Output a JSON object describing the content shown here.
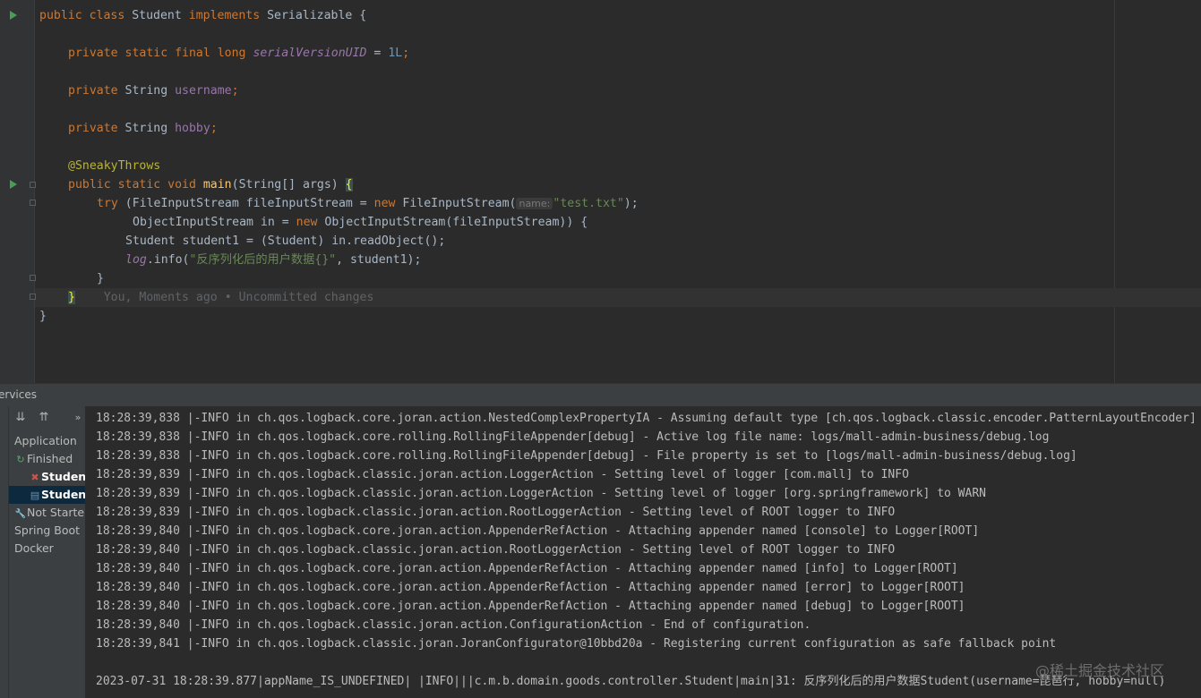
{
  "editor": {
    "lines": {
      "class_decl": {
        "kw1": "public class ",
        "name": "Student ",
        "kw2": "implements ",
        "iface": "Serializable {"
      },
      "serial": {
        "kw": "private static final long ",
        "field": "serialVersionUID",
        "rest": " = ",
        "num": "1L",
        "end": ";"
      },
      "username": {
        "kw": "private ",
        "type": "String ",
        "field": "username",
        "end": ";"
      },
      "hobby": {
        "kw": "private ",
        "type": "String ",
        "field": "hobby",
        "end": ";"
      },
      "annotation": "@SneakyThrows",
      "main": {
        "kw": "public static void ",
        "fn": "main",
        "args": "(String[] args) ",
        "brace": "{"
      },
      "try": {
        "kw": "try ",
        "open": "(FileInputStream fileInputStream = ",
        "kw2": "new ",
        "ctor": "FileInputStream(",
        "hint": "name:",
        "str": "\"test.txt\"",
        "end": ");"
      },
      "ois": {
        "text1": "ObjectInputStream in = ",
        "kw": "new ",
        "text2": "ObjectInputStream(fileInputStream)) {"
      },
      "read": "Student student1 = (Student) in.readObject();",
      "log": {
        "obj": "log",
        "call": ".info(",
        "str": "\"反序列化后的用户数据{}\"",
        "rest": ", student1);"
      },
      "close_try": "}",
      "close_main": "}",
      "blame": "You, Moments ago • Uncommitted changes",
      "close_class": "}"
    }
  },
  "services": {
    "title": "ervices",
    "toolbar": {
      "expand": "⇊",
      "collapse": "⇈",
      "more": "»"
    },
    "tree": [
      {
        "label": "Application",
        "icon": ""
      },
      {
        "label": "Finished",
        "icon": "↻"
      },
      {
        "label": "Studen",
        "icon": "✖"
      },
      {
        "label": "Studen",
        "icon": "▤"
      },
      {
        "label": "Not Starte",
        "icon": "🔧"
      },
      {
        "label": "Spring Boot",
        "icon": ""
      },
      {
        "label": "Docker",
        "icon": ""
      }
    ],
    "console_lines": [
      "18:28:39,838 |-INFO in ch.qos.logback.core.joran.action.NestedComplexPropertyIA - Assuming default type [ch.qos.logback.classic.encoder.PatternLayoutEncoder]",
      "18:28:39,838 |-INFO in ch.qos.logback.core.rolling.RollingFileAppender[debug] - Active log file name: logs/mall-admin-business/debug.log",
      "18:28:39,838 |-INFO in ch.qos.logback.core.rolling.RollingFileAppender[debug] - File property is set to [logs/mall-admin-business/debug.log]",
      "18:28:39,839 |-INFO in ch.qos.logback.classic.joran.action.LoggerAction - Setting level of logger [com.mall] to INFO",
      "18:28:39,839 |-INFO in ch.qos.logback.classic.joran.action.LoggerAction - Setting level of logger [org.springframework] to WARN",
      "18:28:39,839 |-INFO in ch.qos.logback.classic.joran.action.RootLoggerAction - Setting level of ROOT logger to INFO",
      "18:28:39,840 |-INFO in ch.qos.logback.core.joran.action.AppenderRefAction - Attaching appender named [console] to Logger[ROOT]",
      "18:28:39,840 |-INFO in ch.qos.logback.classic.joran.action.RootLoggerAction - Setting level of ROOT logger to INFO",
      "18:28:39,840 |-INFO in ch.qos.logback.core.joran.action.AppenderRefAction - Attaching appender named [info] to Logger[ROOT]",
      "18:28:39,840 |-INFO in ch.qos.logback.core.joran.action.AppenderRefAction - Attaching appender named [error] to Logger[ROOT]",
      "18:28:39,840 |-INFO in ch.qos.logback.core.joran.action.AppenderRefAction - Attaching appender named [debug] to Logger[ROOT]",
      "18:28:39,840 |-INFO in ch.qos.logback.classic.joran.action.ConfigurationAction - End of configuration.",
      "18:28:39,841 |-INFO in ch.qos.logback.classic.joran.JoranConfigurator@10bbd20a - Registering current configuration as safe fallback point",
      "",
      "2023-07-31 18:28:39.877|appName_IS_UNDEFINED| |INFO|||c.m.b.domain.goods.controller.Student|main|31: 反序列化后的用户数据Student(username=琵琶行, hobby=null)"
    ],
    "watermark": "@稀土掘金技术社区"
  }
}
